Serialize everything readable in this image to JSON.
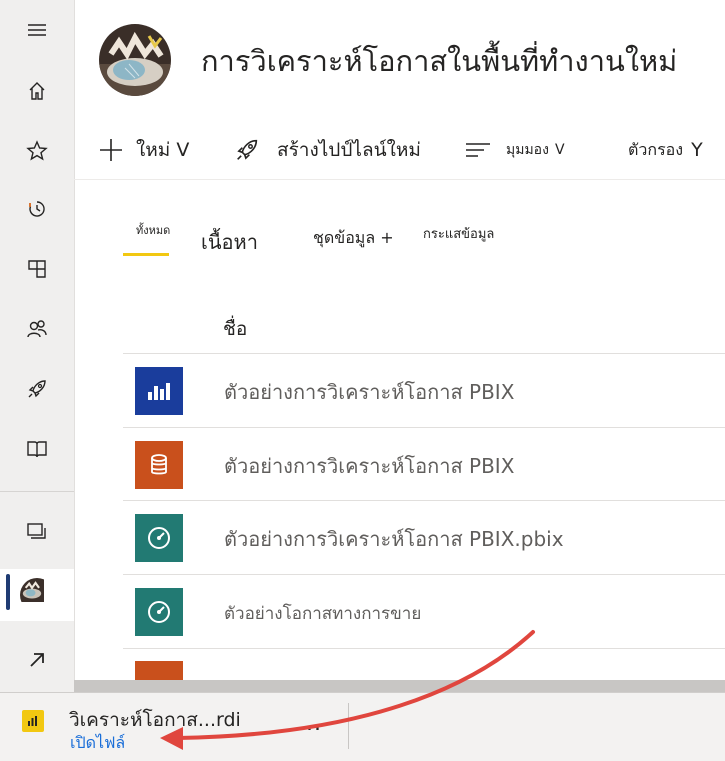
{
  "workspace": {
    "title": "การวิเคราะห์โอกาสในพื้นที่ทำงานใหม่"
  },
  "commands": {
    "new_label": "ใหม่",
    "new_chevron": "V",
    "pipeline_label": "สร้างไปป์ไลน์ใหม่",
    "view_label": "มุมมอง",
    "view_chevron": "V",
    "filter_label": "ตัวกรอง",
    "filter_icon": "Y"
  },
  "tabs": {
    "all": "ทั้งหมด",
    "content": "เนื้อหา",
    "datasets": "ชุดข้อมูล +",
    "dataflows": "กระแสข้อมูล"
  },
  "table": {
    "name_header": "ชื่อ",
    "rows": [
      {
        "name": "ตัวอย่างการวิเคราะห์โอกาส PBIX",
        "icon": "report-icon",
        "color": "#1a3d9c"
      },
      {
        "name": "ตัวอย่างการวิเคราะห์โอกาส PBIX",
        "icon": "dataset-icon",
        "color": "#c9501c"
      },
      {
        "name": "ตัวอย่างการวิเคราะห์โอกาส PBIX.pbix",
        "icon": "dashboard-icon",
        "color": "#227a73"
      },
      {
        "name": "ตัวอย่างโอกาสทางการขาย",
        "icon": "dashboard-icon",
        "color": "#227a73"
      }
    ]
  },
  "download": {
    "filename": "วิเคราะห์โอกาส...rdi",
    "open_label": "เปิดไฟล์",
    "more": "..."
  },
  "colors": {
    "accent_yellow": "#f2c811",
    "link_blue": "#1a6ed8",
    "arrow_red": "#e0463e"
  }
}
